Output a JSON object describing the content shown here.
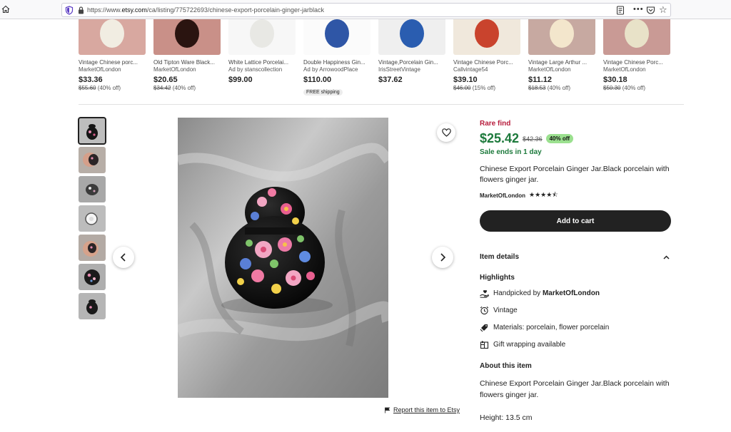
{
  "browser": {
    "url_prefix": "https://www.",
    "url_domain": "etsy.com",
    "url_path": "/ca/listing/775722693/chinese-export-porcelain-ginger-jarblack",
    "more_glyph": "•••",
    "bookmark_glyph": "☆"
  },
  "recommendations": [
    {
      "title": "Vintage Chinese porc...",
      "seller": "MarketOfLondon",
      "price": "$33.36",
      "original": "$55.60",
      "discount": " (40% off)",
      "badge": "",
      "bg": "#d8a8a0",
      "obj": "#f1ede2"
    },
    {
      "title": "Old Tipton Ware Black...",
      "seller": "MarketOfLondon",
      "price": "$20.65",
      "original": "$34.42",
      "discount": " (40% off)",
      "badge": "",
      "bg": "#c99088",
      "obj": "#2a1410"
    },
    {
      "title": "White Lattice Porcelai...",
      "seller": "Ad by stanscollection",
      "price": "$99.00",
      "original": "",
      "discount": "",
      "badge": "",
      "bg": "#f7f7f7",
      "obj": "#e8e8e4"
    },
    {
      "title": "Double Happiness Gin...",
      "seller": "Ad by ArrowoodPlace",
      "price": "$110.00",
      "original": "",
      "discount": "",
      "badge": "FREE shipping",
      "bg": "#fbfbfb",
      "obj": "#2f56a6"
    },
    {
      "title": "Vintage,Porcelain Gin...",
      "seller": "IrisStreetVintage",
      "price": "$37.62",
      "original": "",
      "discount": "",
      "badge": "",
      "bg": "#efefef",
      "obj": "#2a5db0"
    },
    {
      "title": "Vintage Chinese Porc...",
      "seller": "Callvintage54",
      "price": "$39.10",
      "original": "$46.00",
      "discount": " (15% off)",
      "badge": "",
      "bg": "#f0e8dc",
      "obj": "#c9432d"
    },
    {
      "title": "Vintage Large Arthur ...",
      "seller": "MarketOfLondon",
      "price": "$11.12",
      "original": "$18.53",
      "discount": " (40% off)",
      "badge": "",
      "bg": "#c7a9a1",
      "obj": "#f3e6cc"
    },
    {
      "title": "Vintage Chinese Porc...",
      "seller": "MarketOfLondon",
      "price": "$30.18",
      "original": "$50.30",
      "discount": " (40% off)",
      "badge": "",
      "bg": "#c99a95",
      "obj": "#e8e2c8"
    }
  ],
  "product": {
    "rare_find": "Rare find",
    "price": "$25.42",
    "original_price": "$42.36",
    "discount_badge": "40% off",
    "sale_ends": "Sale ends in 1 day",
    "title": "Chinese Export Porcelain Ginger Jar.Black porcelain with flowers ginger jar.",
    "seller": "MarketOfLondon",
    "rating": 4.5,
    "rating_stars": "★★★★⯪",
    "add_to_cart": "Add to cart",
    "report_link": "Report this item to Etsy"
  },
  "details": {
    "heading": "Item details",
    "highlights_heading": "Highlights",
    "handpicked_prefix": "Handpicked by ",
    "handpicked_seller": "MarketOfLondon",
    "vintage": "Vintage",
    "materials": "Materials: porcelain, flower porcelain",
    "gift": "Gift wrapping available",
    "about_heading": "About this item",
    "about_text": "Chinese Export Porcelain Ginger Jar.Black porcelain with flowers ginger jar.",
    "height": "Height: 13.5 cm"
  },
  "colors": {
    "rare": "#b71c3c",
    "sale_green": "#1d7a3c",
    "badge_green": "#9be08f",
    "cart_bg": "#222222"
  }
}
